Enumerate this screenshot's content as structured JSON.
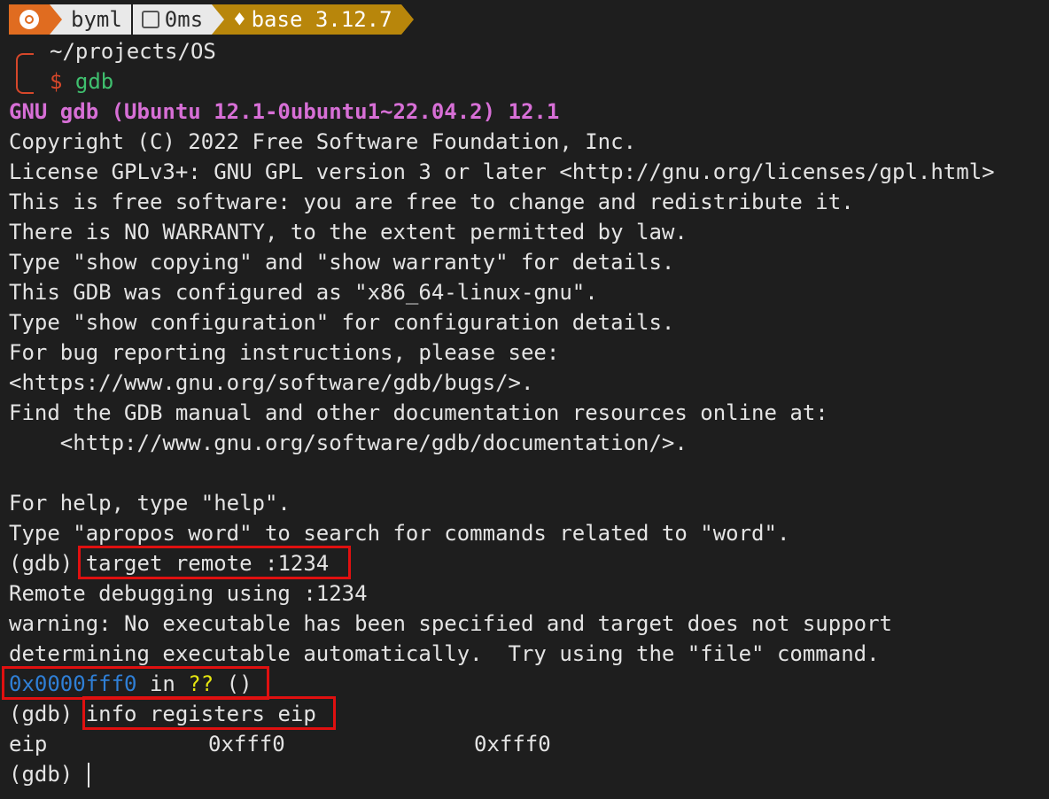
{
  "prompt": {
    "user": "byml",
    "time": "0ms",
    "env": "base 3.12.7",
    "path": "~/projects/OS",
    "symbol": "$",
    "command": "gdb"
  },
  "output": {
    "banner": "GNU gdb (Ubuntu 12.1-0ubuntu1~22.04.2) 12.1",
    "l1": "Copyright (C) 2022 Free Software Foundation, Inc.",
    "l2": "License GPLv3+: GNU GPL version 3 or later <http://gnu.org/licenses/gpl.html>",
    "l3": "This is free software: you are free to change and redistribute it.",
    "l4": "There is NO WARRANTY, to the extent permitted by law.",
    "l5": "Type \"show copying\" and \"show warranty\" for details.",
    "l6": "This GDB was configured as \"x86_64-linux-gnu\".",
    "l7": "Type \"show configuration\" for configuration details.",
    "l8": "For bug reporting instructions, please see:",
    "l9": "<https://www.gnu.org/software/gdb/bugs/>.",
    "l10": "Find the GDB manual and other documentation resources online at:",
    "l11": "    <http://www.gnu.org/software/gdb/documentation/>.",
    "l12": "For help, type \"help\".",
    "l13": "Type \"apropos word\" to search for commands related to \"word\".",
    "gdb_prompt": "(gdb)",
    "cmd1": "target remote :1234",
    "l14": "Remote debugging using :1234",
    "l15": "warning: No executable has been specified and target does not support",
    "l16": "determining executable automatically.  Try using the \"file\" command.",
    "frame_addr": "0x0000fff0",
    "frame_in": " in ",
    "frame_func": "??",
    "frame_args": " ()",
    "cmd2": "info registers eip",
    "reg_name": "eip",
    "reg_hex": "0xfff0",
    "reg_natural": "0xfff0"
  },
  "colors": {
    "background": "#1e1e1e",
    "text": "#e4e4e4",
    "highlight_box": "#e01010",
    "banner": "#d76fd6",
    "address": "#2f7fd6",
    "unknown_func": "#e5e510",
    "prompt_orange": "#e06c20",
    "env_gold": "#b8860b"
  },
  "icons": [
    "ubuntu-icon",
    "terminal-icon",
    "python-icon"
  ]
}
